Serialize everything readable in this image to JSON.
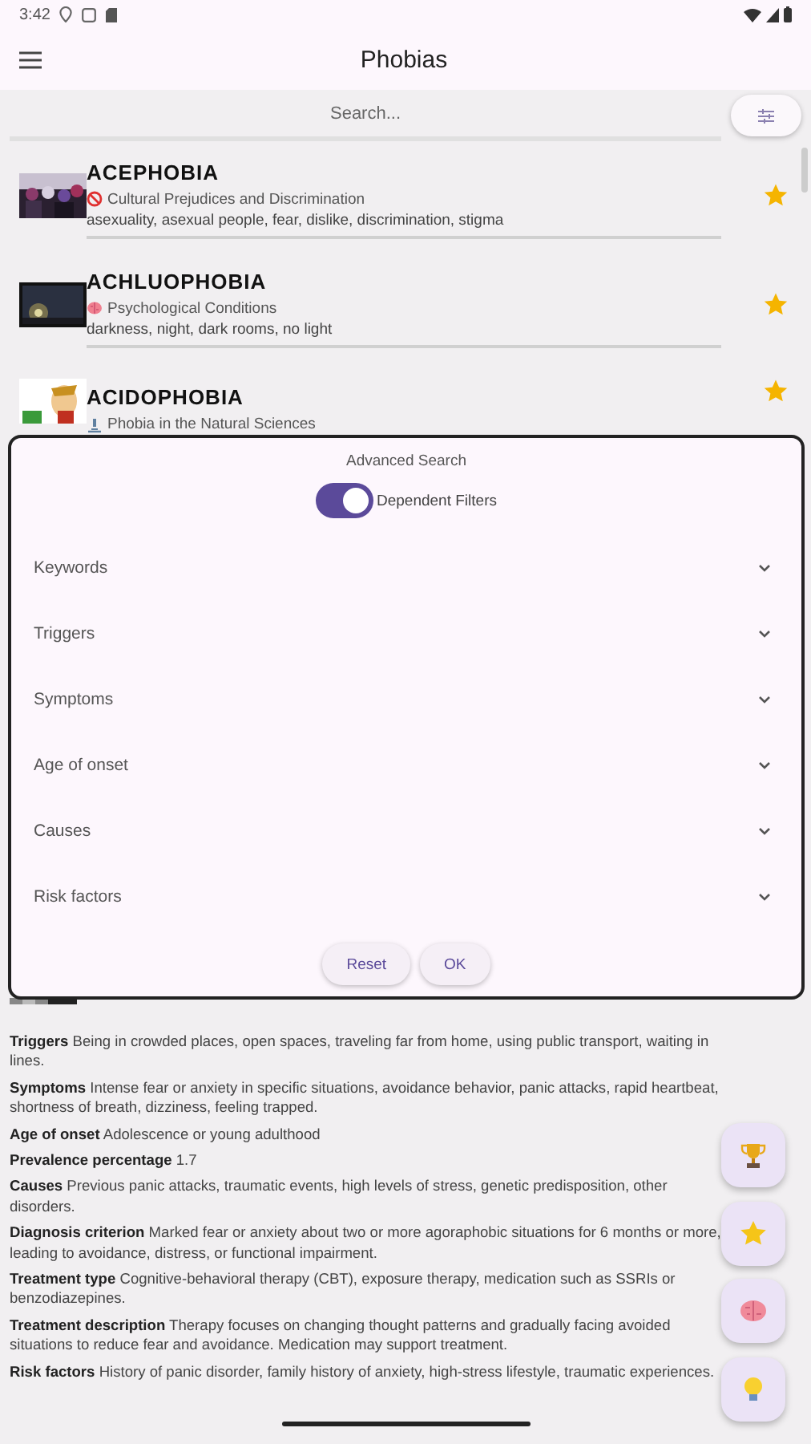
{
  "status_bar": {
    "time": "3:42"
  },
  "app_bar": {
    "title": "Phobias"
  },
  "search": {
    "placeholder": "Search..."
  },
  "phobias": [
    {
      "name": "ACEPHOBIA",
      "category": {
        "kind": "prohibited",
        "label": "Cultural Prejudices and Discrimination"
      },
      "keywords": "asexuality, asexual people, fear, dislike, discrimination, stigma",
      "favorite": true
    },
    {
      "name": "ACHLUOPHOBIA",
      "category": {
        "kind": "brain",
        "label": "Psychological Conditions"
      },
      "keywords": "darkness, night, dark rooms, no light",
      "favorite": true
    },
    {
      "name": "ACIDOPHOBIA",
      "category": {
        "kind": "microscope",
        "label": "Phobia in the Natural Sciences"
      },
      "favorite": true
    }
  ],
  "advanced_search": {
    "title": "Advanced Search",
    "dependent_filters": {
      "label": "Dependent Filters",
      "on": true
    },
    "filters": [
      {
        "label": "Keywords",
        "expanded": false
      },
      {
        "label": "Triggers",
        "expanded": false
      },
      {
        "label": "Symptoms",
        "expanded": false
      },
      {
        "label": "Age of onset",
        "expanded": false
      },
      {
        "label": "Causes",
        "expanded": false
      },
      {
        "label": "Risk factors",
        "expanded": false
      }
    ],
    "buttons": [
      "Reset",
      "OK"
    ]
  },
  "details": [
    {
      "label": "Triggers",
      "text": "Being in crowded places, open spaces, traveling far from home, using public transport, waiting in lines."
    },
    {
      "label": "Symptoms",
      "text": "Intense fear or anxiety in specific situations, avoidance behavior, panic attacks, rapid heartbeat, shortness of breath, dizziness, feeling trapped."
    },
    {
      "label": "Age of onset",
      "text": "Adolescence or young adulthood"
    },
    {
      "label": "Prevalence percentage",
      "text": "1.7"
    },
    {
      "label": "Causes",
      "text": "Previous panic attacks, traumatic events, high levels of stress, genetic predisposition, other disorders."
    },
    {
      "label": "Diagnosis criterion",
      "text": "Marked fear or anxiety about two or more agoraphobic situations for 6 months or more, leading to avoidance, distress, or functional impairment."
    },
    {
      "label": "Treatment type",
      "text": "Cognitive-behavioral therapy (CBT), exposure therapy, medication such as SSRIs or benzodiazepines."
    },
    {
      "label": "Treatment description",
      "text": "Therapy focuses on changing thought patterns and gradually facing avoided situations to reduce fear and avoidance. Medication may support treatment."
    },
    {
      "label": "Risk factors",
      "text": "History of panic disorder, family history of anxiety, high-stress lifestyle, traumatic experiences."
    }
  ],
  "actions": [
    {
      "kind": "trophy"
    },
    {
      "kind": "star"
    },
    {
      "kind": "brain"
    },
    {
      "kind": "bulb"
    }
  ]
}
